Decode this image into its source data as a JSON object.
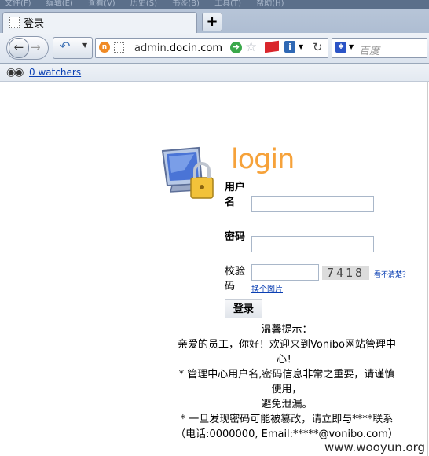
{
  "browser": {
    "menu_items": [
      "文件(F)",
      "编辑(E)",
      "查看(V)",
      "历史(S)",
      "书签(B)",
      "工具(T)",
      "帮助(H)"
    ],
    "tab_title": "登录",
    "new_tab_label": "+",
    "url_prefix": "admin.",
    "url_domain": "docin.com",
    "search_placeholder": "百度",
    "bookmark_watchers": "0 watchers",
    "site_icon_letter": "n",
    "info_icon_letter": "i"
  },
  "login": {
    "logo_text": "login",
    "username_label": "用户名",
    "password_label": "密码",
    "captcha_label": "校验码",
    "captcha_code": "7418",
    "captcha_unclear": "看不清楚？",
    "captcha_change": "换个图片",
    "submit_label": "登录",
    "username_value": "",
    "password_value": "",
    "captcha_value": ""
  },
  "notice": {
    "lines": [
      "温馨提示：",
      "亲爱的员工，你好！欢迎来到Vonibo网站管理中",
      "心！",
      "* 管理中心用户名,密码信息非常之重要，请谨慎",
      "使用，",
      "避免泄漏。",
      "* 一旦发现密码可能被篡改，请立即与****联系",
      "（电话:0000000, Email:*****@vonibo.com）"
    ]
  },
  "watermark": "www.wooyun.org",
  "colors": {
    "logo": "#f6a23a",
    "link": "#0a3fb3",
    "chrome": "#dbe3ee"
  }
}
